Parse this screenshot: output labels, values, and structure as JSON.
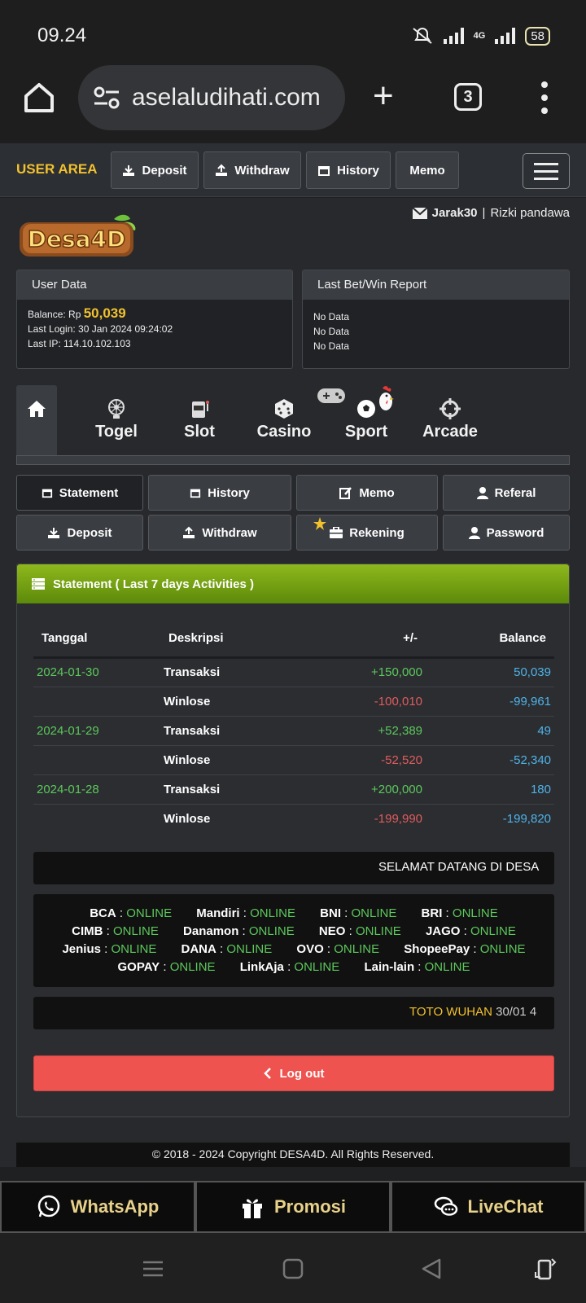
{
  "status_bar": {
    "time": "09.24",
    "network": "4G",
    "battery": "58"
  },
  "browser": {
    "url": "aselaludihati.com",
    "tab_count": "3"
  },
  "user_area": {
    "title": "USER AREA",
    "buttons": {
      "deposit": "Deposit",
      "withdraw": "Withdraw",
      "history": "History",
      "memo": "Memo"
    }
  },
  "user": {
    "username": "Jarak30",
    "separator": "|",
    "full_name": "Rizki pandawa"
  },
  "logo_text": "Desa4D",
  "user_data": {
    "title": "User Data",
    "balance_label": "Balance: Rp",
    "balance_value": "50,039",
    "last_login": "Last Login: 30 Jan 2024 09:24:02",
    "last_ip": "Last IP: 114.10.102.103"
  },
  "bet_report": {
    "title": "Last Bet/Win Report",
    "rows": [
      "No Data",
      "No Data",
      "No Data"
    ]
  },
  "game_nav": [
    "Togel",
    "Slot",
    "Casino",
    "Sport",
    "Arcade"
  ],
  "sub_nav": {
    "statement": "Statement",
    "history": "History",
    "memo": "Memo",
    "referal": "Referal",
    "deposit": "Deposit",
    "withdraw": "Withdraw",
    "rekening": "Rekening",
    "password": "Password"
  },
  "statement": {
    "title": "Statement ( Last 7 days Activities )",
    "columns": [
      "Tanggal",
      "Deskripsi",
      "+/-",
      "Balance"
    ],
    "rows": [
      {
        "date": "2024-01-30",
        "desc": "Transaksi",
        "amount": "+150,000",
        "balance": "50,039"
      },
      {
        "date": "",
        "desc": "Winlose",
        "amount": "-100,010",
        "balance": "-99,961"
      },
      {
        "date": "2024-01-29",
        "desc": "Transaksi",
        "amount": "+52,389",
        "balance": "49"
      },
      {
        "date": "",
        "desc": "Winlose",
        "amount": "-52,520",
        "balance": "-52,340"
      },
      {
        "date": "2024-01-28",
        "desc": "Transaksi",
        "amount": "+200,000",
        "balance": "180"
      },
      {
        "date": "",
        "desc": "Winlose",
        "amount": "-199,990",
        "balance": "-199,820"
      }
    ]
  },
  "marquee_welcome": "SELAMAT DATANG DI DESA",
  "banks": {
    "status": "ONLINE",
    "rows": [
      [
        "BCA",
        "Mandiri",
        "BNI",
        "BRI"
      ],
      [
        "CIMB",
        "Danamon",
        "NEO",
        "JAGO"
      ],
      [
        "Jenius",
        "DANA",
        "OVO",
        "ShopeePay"
      ],
      [
        "GOPAY",
        "LinkAja",
        "Lain-lain"
      ]
    ]
  },
  "result_ticker": {
    "market": "TOTO WUHAN",
    "text": "30/01 4"
  },
  "logout_label": "Log out",
  "footer": "© 2018 - 2024 Copyright DESA4D. All Rights Reserved.",
  "bottom_bar": {
    "whatsapp": "WhatsApp",
    "promosi": "Promosi",
    "livechat": "LiveChat"
  },
  "colors": {
    "accent_yellow": "#f2c12e",
    "online_green": "#5cc85c",
    "negative_red": "#e05c5c",
    "balance_blue": "#4fb3e8",
    "logout_red": "#ef5350"
  }
}
